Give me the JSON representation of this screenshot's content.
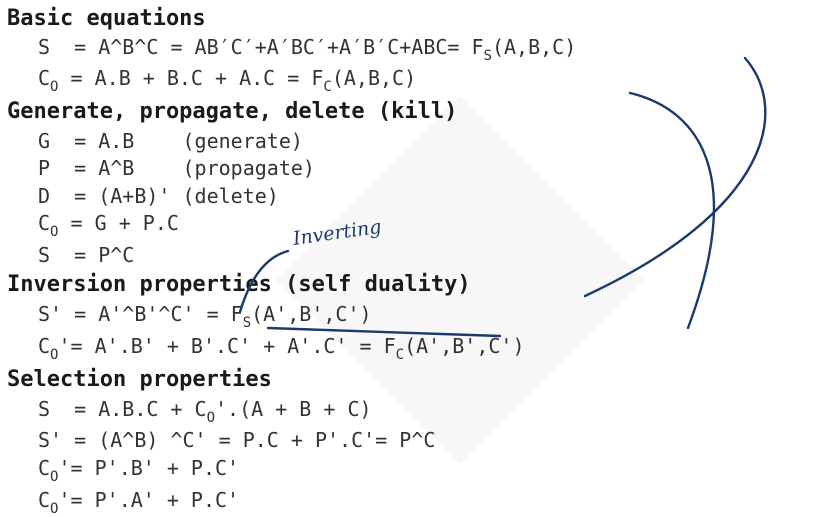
{
  "sections": {
    "basic": {
      "title": "Basic equations",
      "s_lhs": "S  = A^B^C = AB′C′+A′BC′+A′B′C+ABC= F",
      "s_sub": "S",
      "s_rhs": "(A,B,C)",
      "co_c": "C",
      "co_sub": "O",
      "co_mid": " = A.B + B.C + A.C = F",
      "co_fsub": "C",
      "co_rhs": "(A,B,C)"
    },
    "gpd": {
      "title": "Generate, propagate, delete (kill)",
      "g": "G  = A.B    (generate)",
      "p": "P  = A^B    (propagate)",
      "d": "D  = (A+B)' (delete)",
      "co_c": "C",
      "co_sub": "O",
      "co_rest": " = G + P.C",
      "s": "S  = P^C"
    },
    "inversion": {
      "title": "Inversion properties (self duality)",
      "s_lhs": "S' = A'^B'^C' = F",
      "s_sub": "S",
      "s_rhs": "(A',B',C')",
      "co_c": "C",
      "co_sub": "O",
      "co_mid": "'= A'.B' + B'.C' + A'.C' = F",
      "co_fsub": "C",
      "co_rhs": "(A',B',C')"
    },
    "selection": {
      "title": "Selection properties",
      "s1_lhs": "S  = A.B.C + C",
      "s1_sub": "O",
      "s1_rhs": "'.(A + B + C)",
      "s2": "S' = (A^B) ^C' = P.C + P'.C'= P^C",
      "co1_c": "C",
      "co1_sub": "O",
      "co1_rest": "'= P'.B' + P.C'",
      "co2_c": "C",
      "co2_sub": "O",
      "co2_rest": "'= P'.A' + P.C'"
    }
  },
  "annotation": {
    "handwritten_text": "Inverting"
  }
}
